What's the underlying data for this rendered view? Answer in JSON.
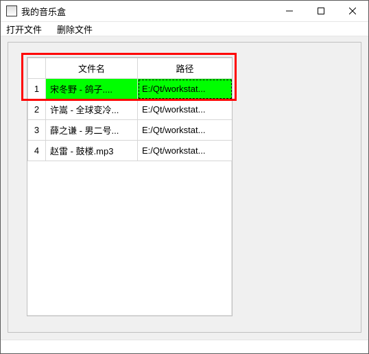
{
  "window": {
    "title": "我的音乐盒"
  },
  "menu": {
    "open_file": "打开文件",
    "delete_file": "删除文件"
  },
  "table": {
    "headers": {
      "filename": "文件名",
      "path": "路径"
    },
    "rows": [
      {
        "n": "1",
        "name": "宋冬野 - 鸽子....",
        "path": "E:/Qt/workstat..."
      },
      {
        "n": "2",
        "name": "许嵩 - 全球变冷...",
        "path": "E:/Qt/workstat..."
      },
      {
        "n": "3",
        "name": "薛之谦 - 男二号...",
        "path": "E:/Qt/workstat..."
      },
      {
        "n": "4",
        "name": "赵雷 - 鼓楼.mp3",
        "path": "E:/Qt/workstat..."
      }
    ],
    "selected_index": 0
  },
  "colors": {
    "selection": "#00ff00",
    "highlight_border": "#ff0000"
  }
}
